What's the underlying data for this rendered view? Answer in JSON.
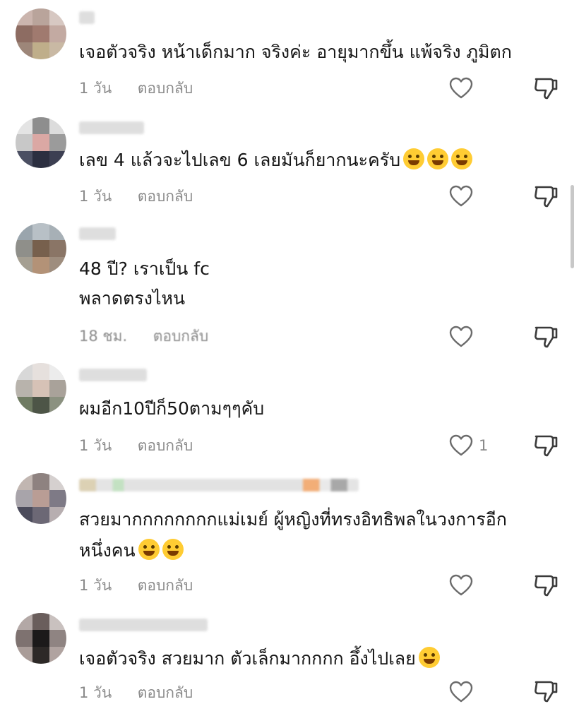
{
  "comments": [
    {
      "text": "เจอตัวจริง หน้าเด็กมาก จริงค่ะ อายุมากขึ้น แพ้จริง ภูมิตก",
      "time": "1 วัน",
      "reply": "ตอบกลับ",
      "likes": ""
    },
    {
      "text": "เลข 4 แล้วจะไปเลข 6 เลยมันก็ยากนะครับ",
      "emoji": "😂😂😂",
      "time": "1 วัน",
      "reply": "ตอบกลับ",
      "likes": ""
    },
    {
      "text": "48 ปี? เราเป็น fc\nพลาดตรงไหน",
      "time": "18 ชม.",
      "reply": "ตอบกลับ",
      "likes": ""
    },
    {
      "text": "ผมอีก10ปีก็50ตามๆๆคับ",
      "time": "1 วัน",
      "reply": "ตอบกลับ",
      "likes": "1"
    },
    {
      "text": "สวยมากกกกกกกกแม่เมย์ ผู้หญิงที่ทรงอิทธิพลในวงการอีก\nหนึ่งคน",
      "emoji": "🥰🥰",
      "time": "1 วัน",
      "reply": "ตอบกลับ",
      "likes": ""
    },
    {
      "text": "เจอตัวจริง สวยมาก ตัวเล็กมากกกก อึ้งไปเลย",
      "emoji": "🥰",
      "time": "1 วัน",
      "reply": "ตอบกลับ",
      "likes": ""
    }
  ],
  "icons": {
    "like": "heart-outline-icon",
    "dislike": "thumbs-down-outline-icon"
  },
  "colors": {
    "meta": "#8a8a8a",
    "text": "#161616"
  }
}
